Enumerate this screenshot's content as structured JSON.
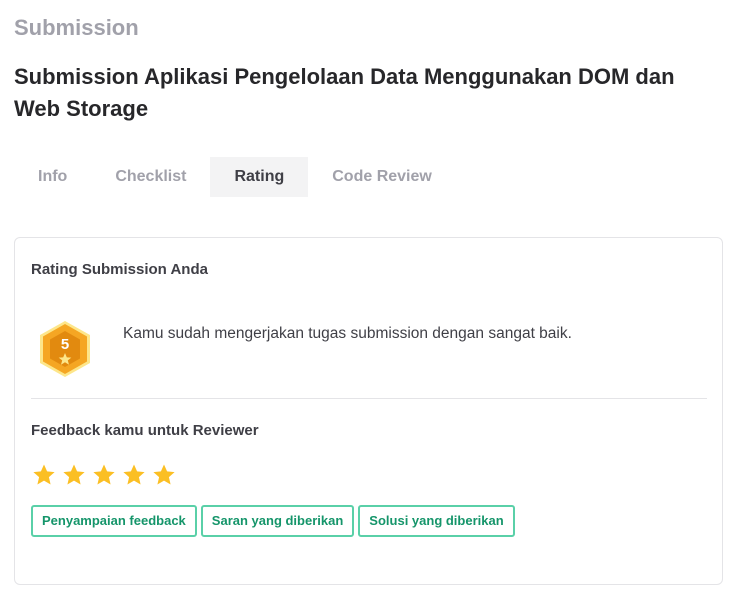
{
  "section_label": "Submission",
  "page_title": "Submission Aplikasi Pengelolaan Data Menggunakan DOM dan Web Storage",
  "tabs": [
    {
      "label": "Info",
      "active": false
    },
    {
      "label": "Checklist",
      "active": false
    },
    {
      "label": "Rating",
      "active": true
    },
    {
      "label": "Code Review",
      "active": false
    }
  ],
  "rating": {
    "heading": "Rating Submission Anda",
    "badge_value": "5",
    "badge_icon": "hexagon-badge-star-icon",
    "message": "Kamu sudah mengerjakan tugas submission dengan sangat baik."
  },
  "feedback": {
    "heading": "Feedback kamu untuk Reviewer",
    "stars_value": 5,
    "stars_max": 5,
    "star_color": "#fbbf24",
    "chips": [
      "Penyampaian feedback",
      "Saran yang diberikan",
      "Solusi yang diberikan"
    ]
  },
  "colors": {
    "badge_gold": "#f5a623",
    "chip_border": "#5ad0a8",
    "chip_text": "#15956a",
    "tab_active_bg": "#f3f3f4"
  }
}
